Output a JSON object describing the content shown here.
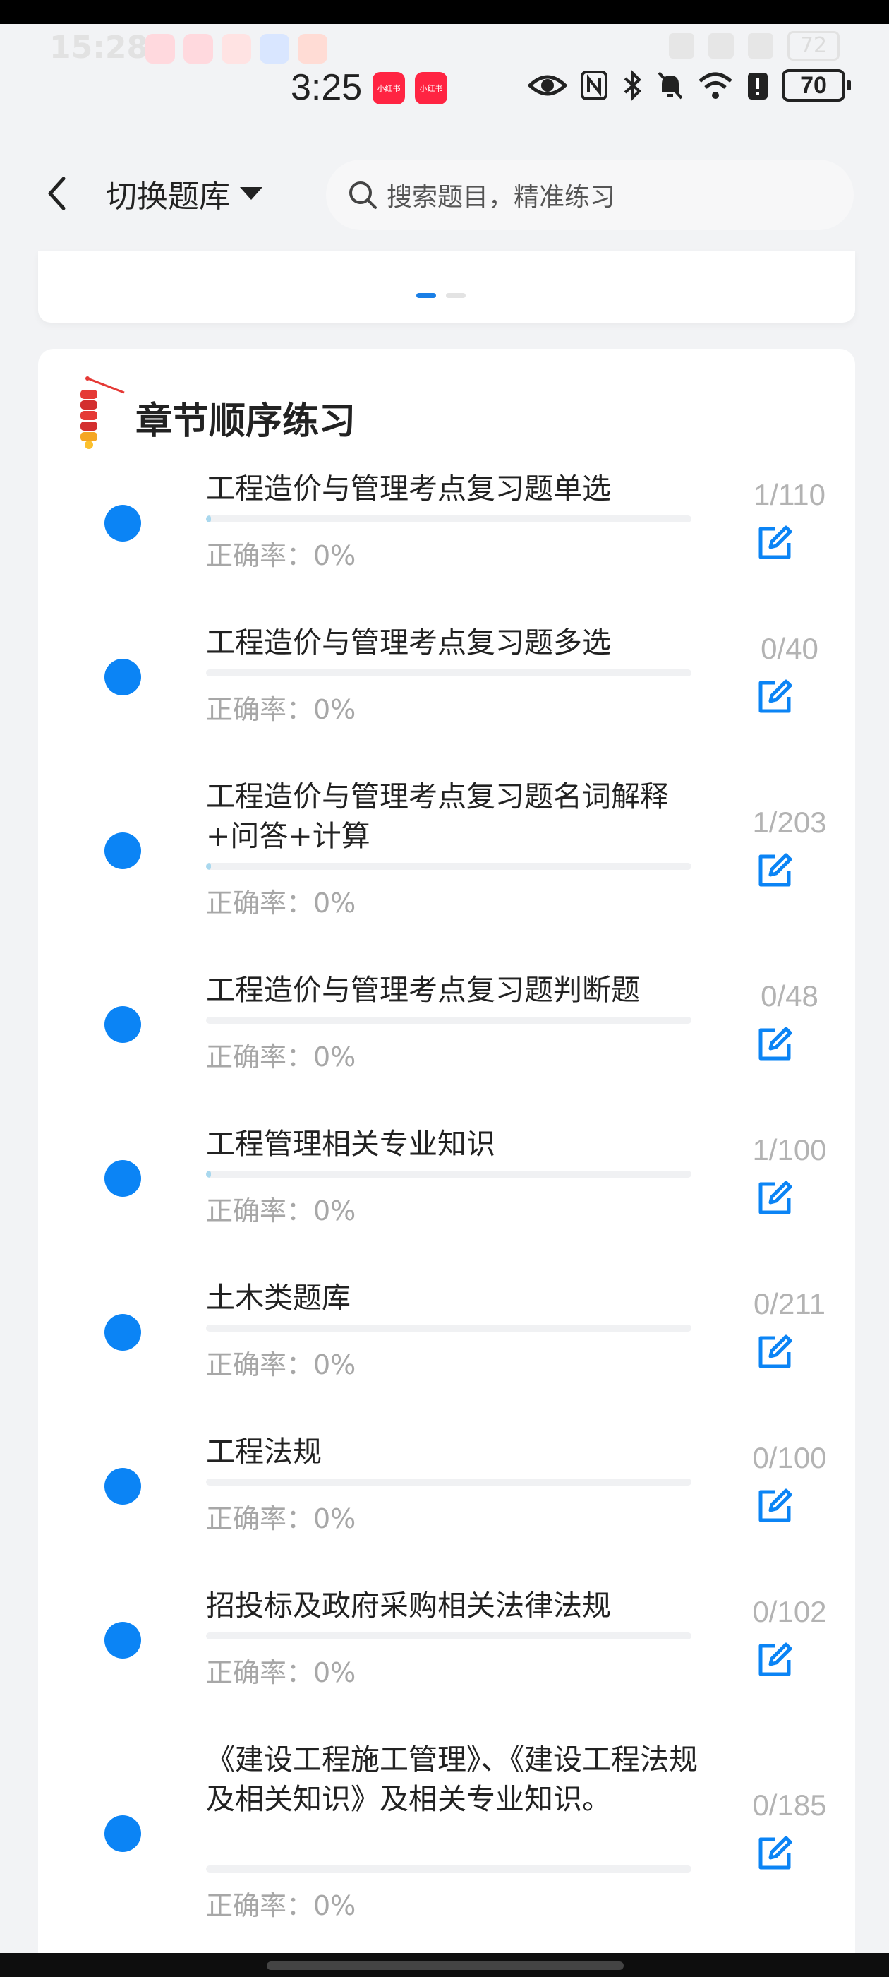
{
  "ghost_status": {
    "time": "15:28",
    "battery": "72"
  },
  "status_bar": {
    "time": "3:25",
    "battery": "70",
    "app_icons": [
      "小红书",
      "小红书"
    ],
    "icons": [
      "eye-icon",
      "nfc-icon",
      "bluetooth-icon",
      "mute-bell-icon",
      "wifi-icon",
      "alert-icon"
    ]
  },
  "header": {
    "switch_bank_label": "切换题库",
    "search_placeholder": "搜索题目，精准练习"
  },
  "chapter_section": {
    "title": "章节顺序练习",
    "accuracy_label": "正确率：0%",
    "items": [
      {
        "title": "工程造价与管理考点复习题单选",
        "count": "1/110",
        "progress": 0.009
      },
      {
        "title": "工程造价与管理考点复习题多选",
        "count": "0/40",
        "progress": 0
      },
      {
        "title": "工程造价与管理考点复习题名词解释+问答+计算",
        "count": "1/203",
        "progress": 0.005
      },
      {
        "title": "工程造价与管理考点复习题判断题",
        "count": "0/48",
        "progress": 0
      },
      {
        "title": "工程管理相关专业知识",
        "count": "1/100",
        "progress": 0.01
      },
      {
        "title": "土木类题库",
        "count": "0/211",
        "progress": 0
      },
      {
        "title": "工程法规",
        "count": "0/100",
        "progress": 0
      },
      {
        "title": "招投标及政府采购相关法律法规",
        "count": "0/102",
        "progress": 0
      },
      {
        "title": "《建设工程施工管理》、《建设工程法规及相关知识》及相关专业知识。",
        "count": "0/185",
        "progress": 0
      }
    ]
  },
  "colors": {
    "accent": "#0b84f5",
    "progress_fill": "#a9d8ee",
    "muted_text": "#a7a7a7"
  }
}
